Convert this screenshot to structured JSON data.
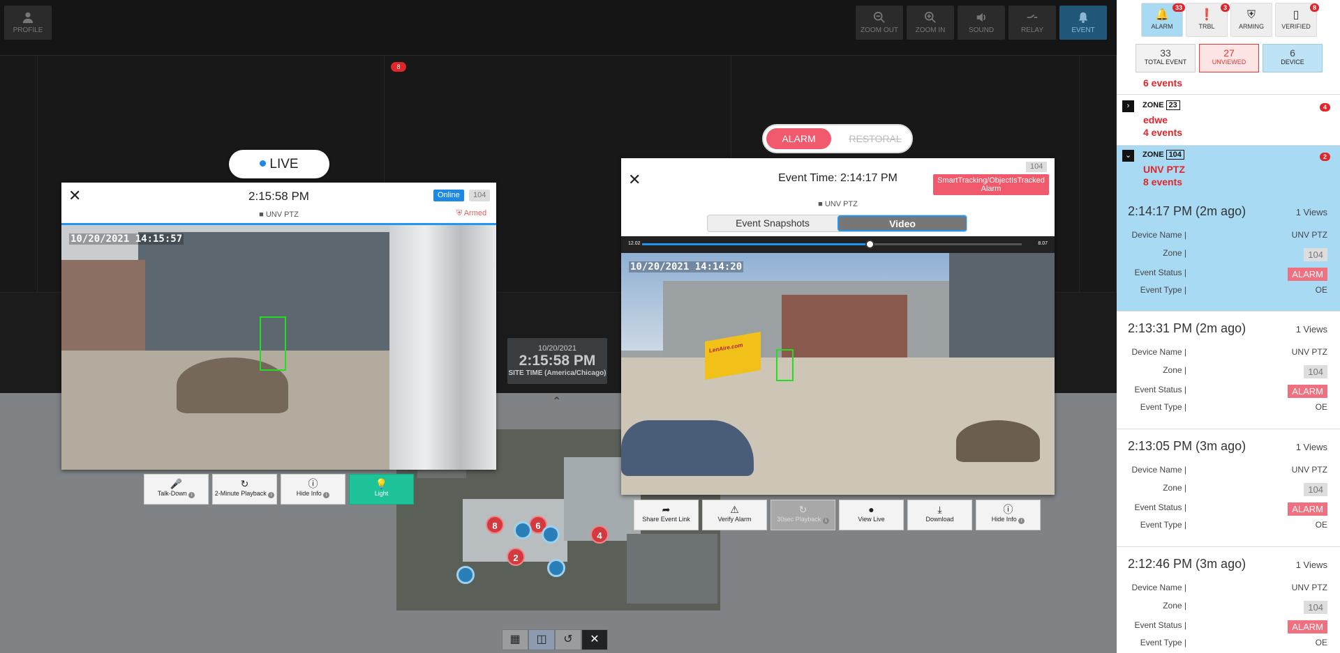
{
  "topbar": {
    "profile": "PROFILE",
    "buttons": [
      "ZOOM OUT",
      "ZOOM IN",
      "SOUND",
      "RELAY",
      "EVENT"
    ]
  },
  "grid": {
    "badge": "8"
  },
  "site_time": {
    "date": "10/20/2021",
    "time": "2:15:58 PM",
    "zone": "SITE TIME (America/Chicago)"
  },
  "map": {
    "pins": [
      "8",
      "6",
      "4",
      "2"
    ]
  },
  "live": {
    "pill": "LIVE",
    "time": "2:15:58 PM",
    "online": "Online",
    "zone": "104",
    "camera": "UNV PTZ",
    "armed": "Armed",
    "osd": "10/20/2021 14:15:57",
    "actions": [
      "Talk-Down",
      "2-Minute Playback",
      "Hide Info",
      "Light"
    ]
  },
  "toggle": {
    "alarm": "ALARM",
    "restoral": "RESTORAL"
  },
  "event": {
    "zone": "104",
    "time": "Event Time: 2:14:17 PM",
    "type_line1": "SmartTracking/ObjectIsTracked",
    "type_line2": "Alarm",
    "camera": "UNV PTZ",
    "tab_snapshots": "Event Snapshots",
    "tab_video": "Video",
    "scrub_start": "12.02",
    "scrub_end": "8.07",
    "scrub_progress": 0.6,
    "osd": "10/20/2021 14:14:20",
    "truck_text": "LenAire.com",
    "actions": [
      "Share Event Link",
      "Verify Alarm",
      "30sec Playback",
      "View Live",
      "Download",
      "Hide Info"
    ]
  },
  "sidebar": {
    "tabs": [
      {
        "label": "ALARM",
        "count": "33"
      },
      {
        "label": "TRBL",
        "count": "3"
      },
      {
        "label": "ARMING",
        "count": ""
      },
      {
        "label": "VERIFIED",
        "count": "8"
      }
    ],
    "stats": [
      {
        "n": "33",
        "label": "TOTAL EVENT"
      },
      {
        "n": "27",
        "label": "UNVIEWED"
      },
      {
        "n": "6",
        "label": "DEVICE"
      }
    ],
    "top_events": "6 events",
    "zone_word": "ZONE",
    "zones": [
      {
        "zone": "23",
        "name": "edwe",
        "events": "4 events",
        "count": "4"
      },
      {
        "zone": "104",
        "name": "UNV PTZ",
        "events": "8 events",
        "count": "2"
      }
    ],
    "labels": {
      "device": "Device Name |",
      "zone": "Zone |",
      "status": "Event Status |",
      "type": "Event Type |"
    },
    "cards": [
      {
        "time": "2:14:17 PM (2m ago)",
        "views": "1 Views",
        "device": "UNV PTZ",
        "zone": "104",
        "status": "ALARM",
        "type": "OE"
      },
      {
        "time": "2:13:31 PM (2m ago)",
        "views": "1 Views",
        "device": "UNV PTZ",
        "zone": "104",
        "status": "ALARM",
        "type": "OE"
      },
      {
        "time": "2:13:05 PM (3m ago)",
        "views": "1 Views",
        "device": "UNV PTZ",
        "zone": "104",
        "status": "ALARM",
        "type": "OE"
      },
      {
        "time": "2:12:46 PM (3m ago)",
        "views": "1 Views",
        "device": "UNV PTZ",
        "zone": "104",
        "status": "ALARM",
        "type": "OE"
      }
    ]
  }
}
